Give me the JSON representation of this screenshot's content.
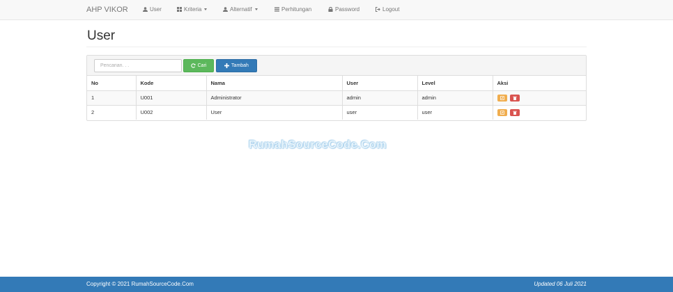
{
  "nav": {
    "brand": "AHP VIKOR",
    "items": [
      {
        "label": "User",
        "icon": "user-icon"
      },
      {
        "label": "Kriteria",
        "icon": "th-icon",
        "dropdown": true
      },
      {
        "label": "Alternatif",
        "icon": "user-icon",
        "dropdown": true
      },
      {
        "label": "Perhitungan",
        "icon": "list-icon"
      },
      {
        "label": "Password",
        "icon": "lock-icon"
      },
      {
        "label": "Logout",
        "icon": "logout-icon"
      }
    ]
  },
  "page": {
    "title": "User"
  },
  "toolbar": {
    "search_placeholder": "Pencarian. . .",
    "search_value": "",
    "cari_label": "Cari",
    "tambah_label": "Tambah"
  },
  "table": {
    "headers": [
      "No",
      "Kode",
      "Nama",
      "User",
      "Level",
      "Aksi"
    ],
    "rows": [
      {
        "no": "1",
        "kode": "U001",
        "nama": "Administrator",
        "user": "admin",
        "level": "admin"
      },
      {
        "no": "2",
        "kode": "U002",
        "nama": "User",
        "user": "user",
        "level": "user"
      }
    ]
  },
  "watermark": "RumahSourceCode.Com",
  "footer": {
    "copyright": "Copyright © 2021 RumahSourceCode.Com",
    "updated": "Updated 06 Juli 2021"
  },
  "colors": {
    "primary": "#337ab7",
    "success": "#5cb85c",
    "warning": "#f0ad4e",
    "danger": "#d9534f",
    "navbar_bg": "#f8f8f8"
  }
}
